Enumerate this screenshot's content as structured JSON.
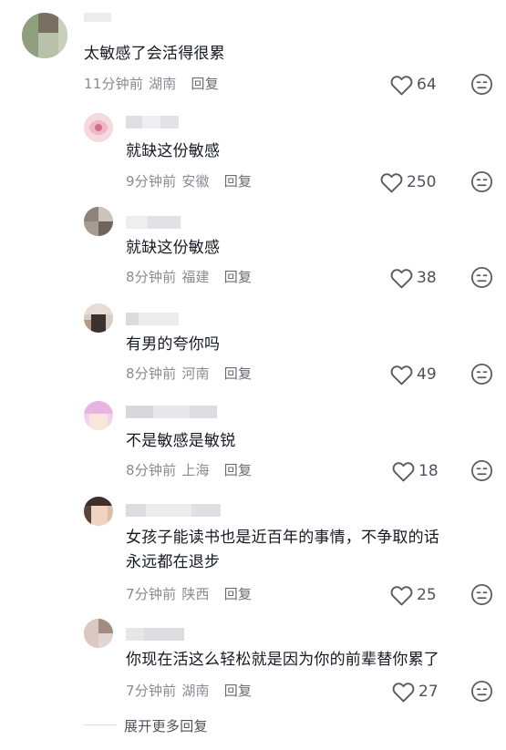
{
  "colors": {
    "text": "#161823",
    "meta": "#8a8b91",
    "icon": "#5a5b61"
  },
  "icons": {
    "like": "heart-outline",
    "dislike": "neutral-face"
  },
  "comments": [
    {
      "text_lines": [
        "太敏感了会活得很累"
      ],
      "time": "11分钟前",
      "location": "湖南",
      "reply": "回复",
      "likes": "64"
    },
    {
      "text_lines": [
        "就缺这份敏感"
      ],
      "time": "9分钟前",
      "location": "安徽",
      "reply": "回复",
      "likes": "250"
    },
    {
      "text_lines": [
        "就缺这份敏感"
      ],
      "time": "8分钟前",
      "location": "福建",
      "reply": "回复",
      "likes": "38"
    },
    {
      "text_lines": [
        "有男的夸你吗"
      ],
      "time": "8分钟前",
      "location": "河南",
      "reply": "回复",
      "likes": "49"
    },
    {
      "text_lines": [
        "不是敏感是敏锐"
      ],
      "time": "8分钟前",
      "location": "上海",
      "reply": "回复",
      "likes": "18"
    },
    {
      "text_lines": [
        "女孩子能读书也是近百年的事情，不争取的话",
        "永远都在退步"
      ],
      "time": "7分钟前",
      "location": "陕西",
      "reply": "回复",
      "likes": "25"
    },
    {
      "text_lines": [
        "你现在活这么轻松就是因为你的前辈替你累了"
      ],
      "time": "7分钟前",
      "location": "湖南",
      "reply": "回复",
      "likes": "27"
    }
  ],
  "expand_more": "展开更多回复"
}
